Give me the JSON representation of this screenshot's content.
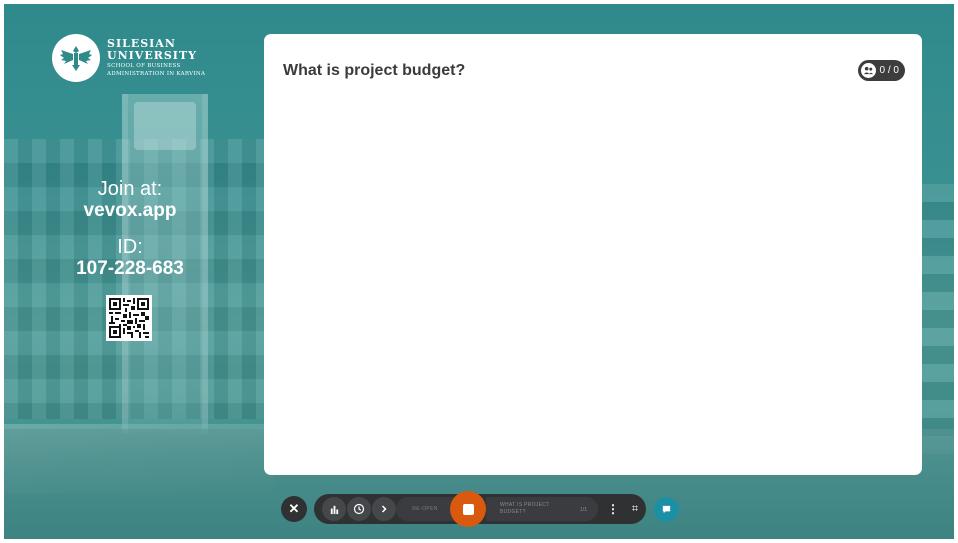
{
  "logo": {
    "line1": "SILESIAN",
    "line2": "UNIVERSITY",
    "line3": "SCHOOL OF BUSINESS",
    "line4": "ADMINISTRATION IN KARVINA"
  },
  "join": {
    "label": "Join at:",
    "url": "vevox.app",
    "id_label": "ID:",
    "id_value": "107-228-683"
  },
  "card": {
    "question": "What is project budget?",
    "responses": "0 / 0"
  },
  "toolbar": {
    "reopen_label": "RE-OPEN",
    "question_name": "WHAT IS PROJECT BUDGET?",
    "question_number": "1/1"
  },
  "colors": {
    "accent": "#d9590f",
    "toolbar": "#2f3133",
    "chat": "#1b8fa3",
    "background": "#3a9091"
  }
}
